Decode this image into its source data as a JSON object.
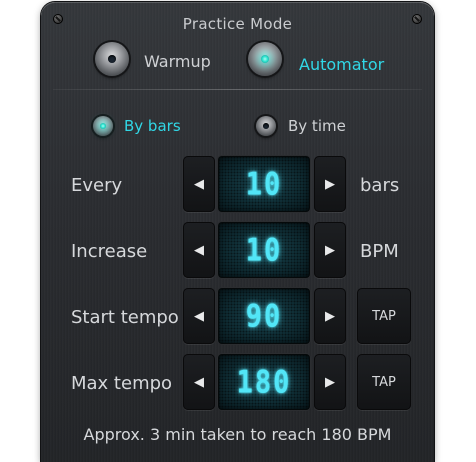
{
  "panel": {
    "title": "Practice Mode"
  },
  "mode": {
    "warmup_label": "Warmup",
    "automator_label": "Automator",
    "selected": "Automator"
  },
  "submode": {
    "by_bars_label": "By bars",
    "by_time_label": "By time",
    "selected": "By bars"
  },
  "rows": {
    "every": {
      "label": "Every",
      "value": "10",
      "unit": "bars"
    },
    "increase": {
      "label": "Increase",
      "value": "10",
      "unit": "BPM"
    },
    "start_tempo": {
      "label": "Start tempo",
      "value": "90",
      "tap_label": "TAP"
    },
    "max_tempo": {
      "label": "Max tempo",
      "value": "180",
      "tap_label": "TAP"
    }
  },
  "icons": {
    "decrement": "◀",
    "increment": "▶"
  },
  "status": "Approx. 3 min taken to reach 180 BPM",
  "colors": {
    "accent": "#31d7e6",
    "lcd_digits": "#52e6f7"
  }
}
